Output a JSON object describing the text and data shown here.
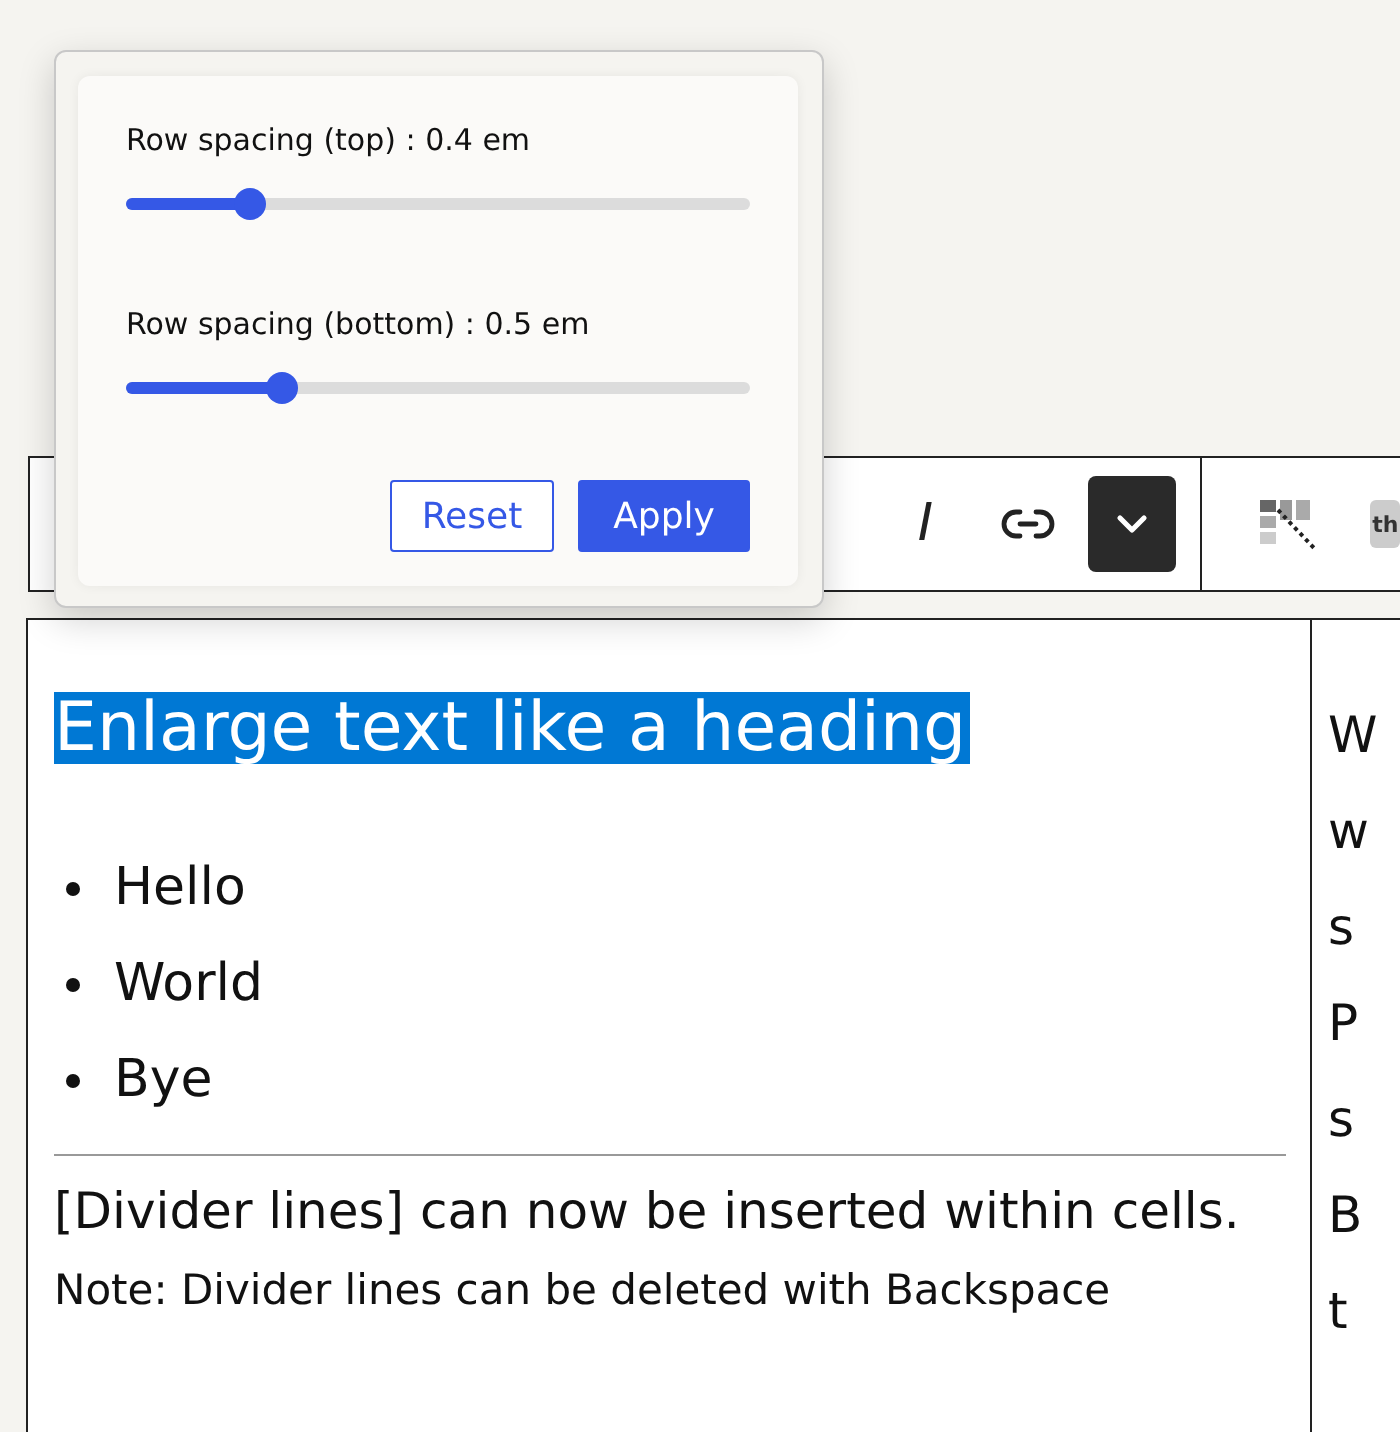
{
  "toolbar": {
    "items": [
      {
        "kind": "italic",
        "label": "I"
      },
      {
        "kind": "link"
      },
      {
        "kind": "dropdown"
      },
      {
        "kind": "divider"
      },
      {
        "kind": "cells"
      },
      {
        "kind": "header",
        "label": "th"
      }
    ]
  },
  "popover": {
    "sliders": [
      {
        "label": "Row spacing (top) : 0.4 em",
        "level": 0.2
      },
      {
        "label": "Row spacing (bottom) : 0.5 em",
        "level": 0.25
      }
    ],
    "buttons": [
      {
        "label": "Reset",
        "kind": "secondary"
      },
      {
        "label": "Apply",
        "kind": "primary"
      }
    ]
  },
  "table": {
    "cell_1": {
      "heading": "Enlarge text like a heading",
      "heading_selected": true,
      "list": [
        "Hello",
        "World",
        "Bye"
      ],
      "paragraph": "[Divider lines] can now be inserted within cells.",
      "note": "Note: Divider lines can be deleted with Backspace"
    },
    "column_2_lines": [
      "W",
      "w",
      "s",
      "P",
      "s",
      "B",
      "t"
    ]
  }
}
